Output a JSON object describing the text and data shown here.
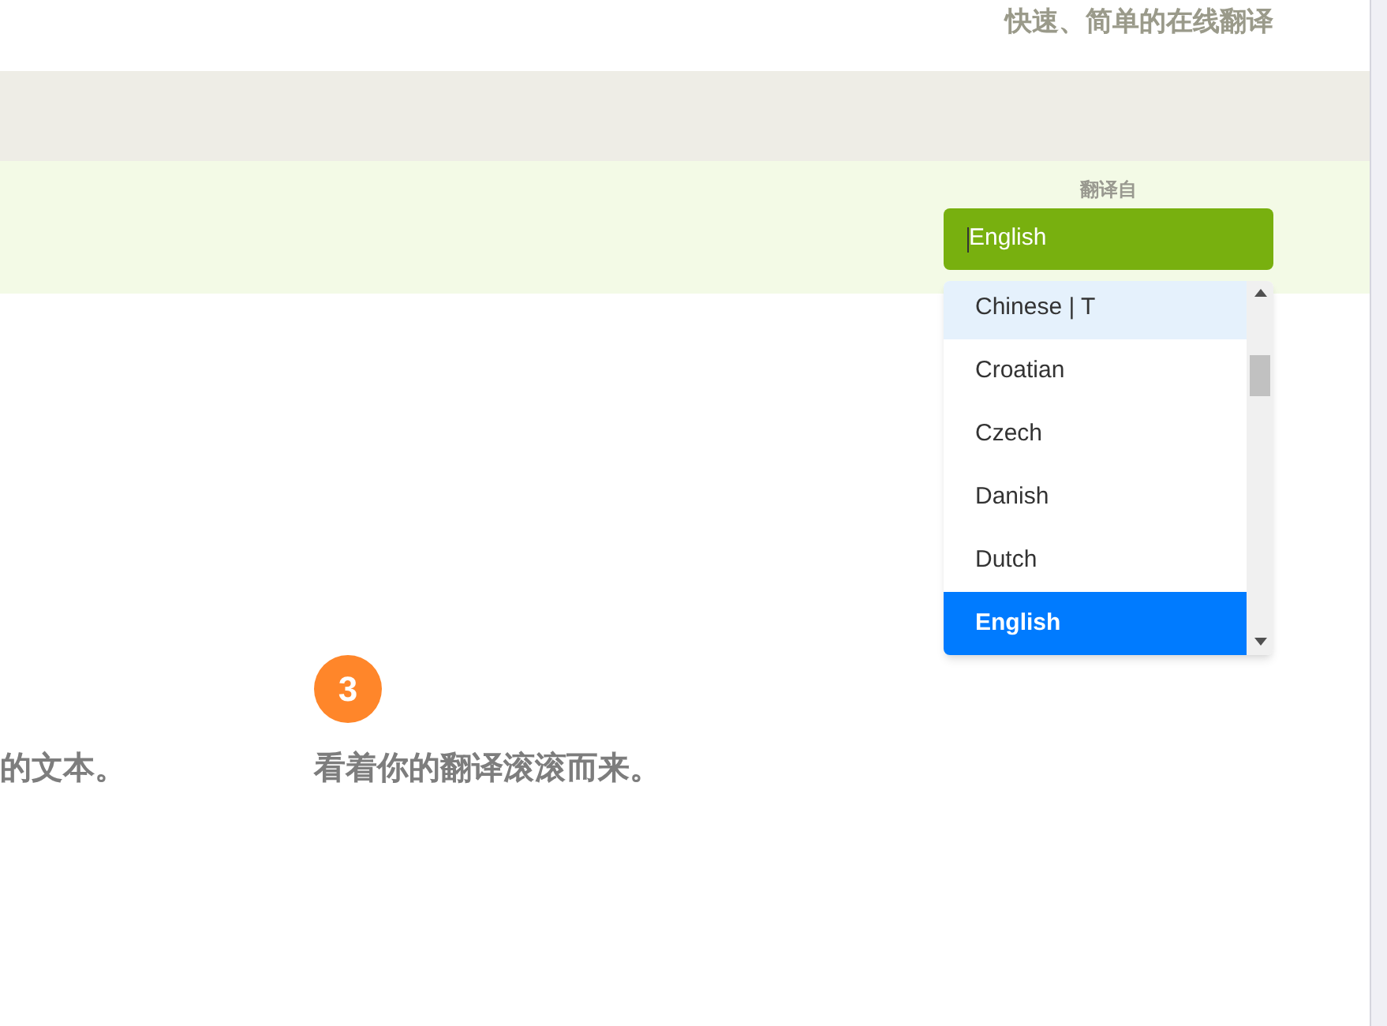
{
  "header": {
    "tagline": "快速、简单的在线翻译"
  },
  "translate_from": {
    "label": "翻译自",
    "value": "English",
    "options": [
      {
        "label": "Chinese | T",
        "hovered": true,
        "selected": false
      },
      {
        "label": "Croatian",
        "hovered": false,
        "selected": false
      },
      {
        "label": "Czech",
        "hovered": false,
        "selected": false
      },
      {
        "label": "Danish",
        "hovered": false,
        "selected": false
      },
      {
        "label": "Dutch",
        "hovered": false,
        "selected": false
      },
      {
        "label": "English",
        "hovered": false,
        "selected": true
      }
    ]
  },
  "steps": [
    {
      "text": "的文本。"
    },
    {
      "number": "3",
      "text": "看着你的翻译滚滚而来。"
    }
  ]
}
